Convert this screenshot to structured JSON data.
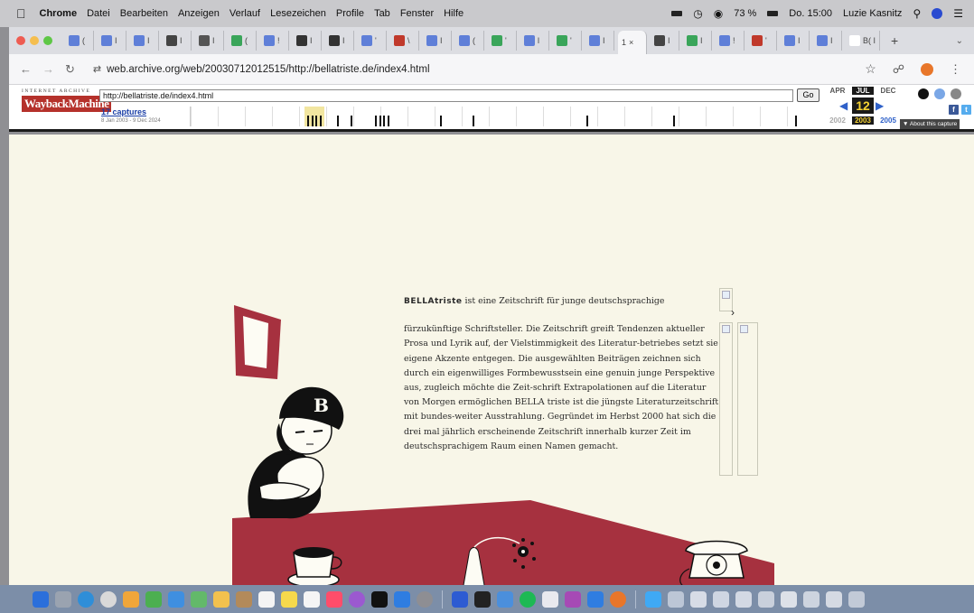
{
  "menubar": {
    "app_name": "Chrome",
    "menus": [
      "Datei",
      "Bearbeiten",
      "Anzeigen",
      "Verlauf",
      "Lesezeichen",
      "Profile",
      "Tab",
      "Fenster",
      "Hilfe"
    ],
    "battery": "73 %",
    "datetime": "Do. 15:00",
    "user": "Luzie Kasnitz"
  },
  "tabs": {
    "items": [
      {
        "label": "(",
        "color": "#5f7fd8"
      },
      {
        "label": "I",
        "color": "#5f7fd8"
      },
      {
        "label": "I",
        "color": "#5f7fd8"
      },
      {
        "label": "I",
        "color": "#444444"
      },
      {
        "label": "I",
        "color": "#555555"
      },
      {
        "label": "(",
        "color": "#3aa55a"
      },
      {
        "label": "!",
        "color": "#5f7fd8"
      },
      {
        "label": "I",
        "color": "#333333"
      },
      {
        "label": "I",
        "color": "#333333"
      },
      {
        "label": "'",
        "color": "#5f7fd8"
      },
      {
        "label": "\\",
        "color": "#c0392b"
      },
      {
        "label": "I",
        "color": "#5f7fd8"
      },
      {
        "label": "(",
        "color": "#5f7fd8"
      },
      {
        "label": "'",
        "color": "#3aa55a"
      },
      {
        "label": "l",
        "color": "#5f7fd8"
      },
      {
        "label": "'",
        "color": "#3aa55a"
      },
      {
        "label": "I",
        "color": "#5f7fd8"
      }
    ],
    "active_label": "1",
    "after_active": [
      {
        "label": "I",
        "color": "#444444"
      },
      {
        "label": "I",
        "color": "#3aa55a"
      },
      {
        "label": "!",
        "color": "#5f7fd8"
      },
      {
        "label": "'",
        "color": "#c0392b"
      },
      {
        "label": "I",
        "color": "#5f7fd8"
      },
      {
        "label": "I",
        "color": "#5f7fd8"
      },
      {
        "label": "B( I",
        "color": "#ffffff"
      }
    ],
    "new_tab": "+",
    "close": "×"
  },
  "address": {
    "url": "web.archive.org/web/20030712012515/http://bellatriste.de/index4.html"
  },
  "wayback": {
    "ia_label": "INTERNET ARCHIVE",
    "logo_text": "WaybackMachine",
    "url_field": "http://bellatriste.de/index4.html",
    "go_label": "Go",
    "captures": "17 captures",
    "range": "8 Jan 2003 - 9 Dec 2024",
    "months": {
      "prev": "APR",
      "cur": "JUL",
      "next": "DEC"
    },
    "day": "12",
    "years": {
      "prev": "2002",
      "cur": "2003",
      "next": "2005"
    },
    "about": "▼ About this capture"
  },
  "article": {
    "brand": "BELLAtriste",
    "intro": " ist eine Zeitschrift für junge deutschsprachige",
    "body": "fürzukünftige Schriftsteller. Die Zeitschrift greift Tendenzen aktueller Prosa und Lyrik auf, der Vielstimmigkeit des Literatur-betriebes setzt sie eigene Akzente entgegen. Die ausgewählten Beiträgen zeichnen sich durch ein eigenwilliges Formbewusstsein eine genuin junge Perspektive aus, zugleich möchte die Zeit-schrift Extrapolationen auf die Literatur von Morgen ermöglichen BELLA triste ist die jüngste Literaturzeitschrift mit bundes-weiter Ausstrahlung. Gegründet im Herbst 2000 hat sich die drei mal jährlich erscheinende Zeitschrift innerhalb kurzer Zeit im deutschsprachigem Raum einen Namen gemacht."
  },
  "illustration": {
    "cap_letter": "B"
  },
  "colors": {
    "page_bg": "#f8f6e8",
    "accent_red": "#a6313f",
    "wayback_red": "#b5312b"
  }
}
